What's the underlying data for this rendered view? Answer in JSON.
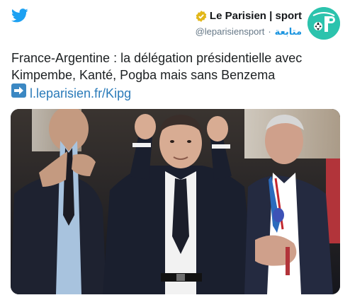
{
  "author": {
    "name": "Le Parisien | sport",
    "handle": "@leparisiensport",
    "follow_label": "متابعة",
    "separator": "·"
  },
  "tweet": {
    "text_line1": "France-Argentine : la délégation présidentielle avec",
    "text_line2": "Kimpembe, Kanté, Pogba mais sans Benzema",
    "link": "l.leparisien.fr/Kipg"
  },
  "icons": {
    "platform": "twitter-bird-icon",
    "verified": "verified-badge-icon",
    "link_arrow": "right-arrow-emoji-icon"
  },
  "colors": {
    "twitter_blue": "#1da1f2",
    "link_blue": "#2b7bb9",
    "verified_gold": "#e2b719",
    "avatar_teal": "#2cc3ad"
  }
}
